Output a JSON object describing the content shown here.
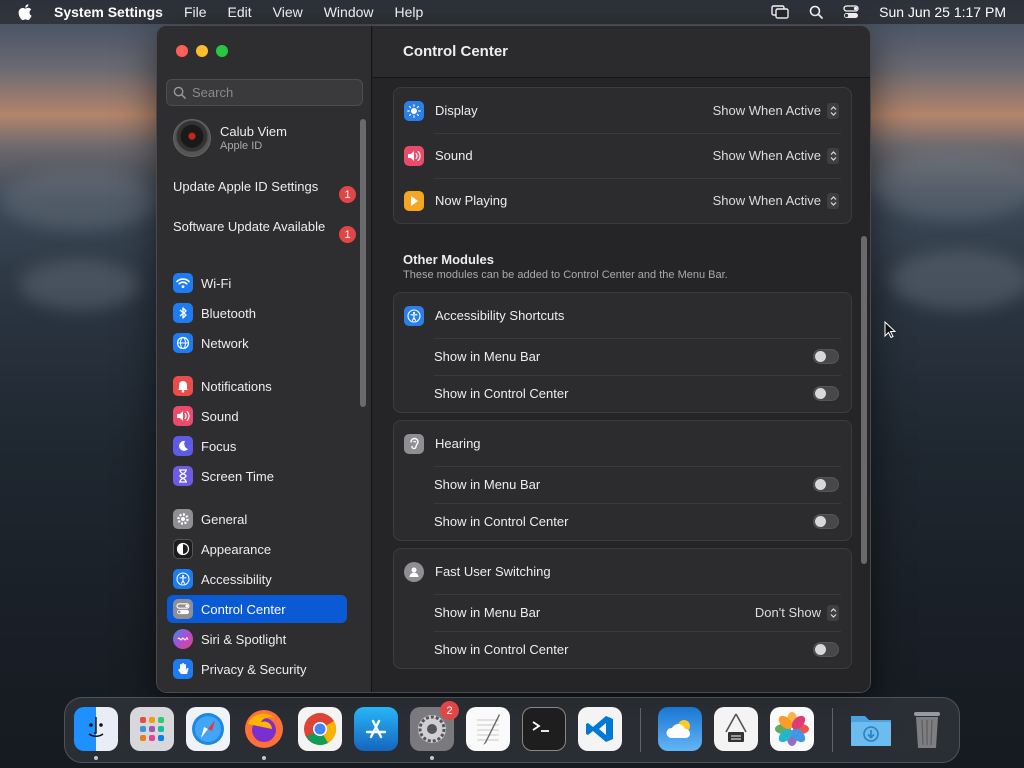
{
  "menubar": {
    "app_name": "System Settings",
    "menus": [
      "File",
      "Edit",
      "View",
      "Window",
      "Help"
    ],
    "clock": "Sun Jun 25  1:17 PM"
  },
  "window": {
    "title": "Control Center",
    "search_placeholder": "Search"
  },
  "profile": {
    "name": "Calub Viem",
    "sub": "Apple ID"
  },
  "notices": [
    {
      "label": "Update Apple ID Settings",
      "badge": "1"
    },
    {
      "label": "Software Update Available",
      "badge": "1"
    }
  ],
  "sidebar": {
    "items": [
      {
        "label": "Wi-Fi",
        "icon": "wifi-icon",
        "color": "#1e7cf2"
      },
      {
        "label": "Bluetooth",
        "icon": "bluetooth-icon",
        "color": "#1e7cf2"
      },
      {
        "label": "Network",
        "icon": "network-globe-icon",
        "color": "#1e7cf2"
      },
      {
        "label": "Notifications",
        "icon": "bell-icon",
        "color": "#ea4b4b"
      },
      {
        "label": "Sound",
        "icon": "speaker-icon",
        "color": "#ea4b6b"
      },
      {
        "label": "Focus",
        "icon": "moon-icon",
        "color": "#5e5ce6"
      },
      {
        "label": "Screen Time",
        "icon": "hourglass-icon",
        "color": "#6e5ce6"
      },
      {
        "label": "General",
        "icon": "gear-icon",
        "color": "#8e8e93"
      },
      {
        "label": "Appearance",
        "icon": "appearance-icon",
        "color": "#1c1c1e"
      },
      {
        "label": "Accessibility",
        "icon": "accessibility-icon",
        "color": "#1e7cf2"
      },
      {
        "label": "Control Center",
        "icon": "control-center-icon",
        "color": "#8e8e93"
      },
      {
        "label": "Siri & Spotlight",
        "icon": "siri-icon",
        "color": "#9a46d6"
      },
      {
        "label": "Privacy & Security",
        "icon": "hand-icon",
        "color": "#1e7cf2"
      }
    ]
  },
  "modules": [
    {
      "label": "Display",
      "value": "Show When Active",
      "icon": "display-brightness-icon",
      "color": "#2b7fe8"
    },
    {
      "label": "Sound",
      "value": "Show When Active",
      "icon": "speaker-icon",
      "color": "#ea4b6b"
    },
    {
      "label": "Now Playing",
      "value": "Show When Active",
      "icon": "play-icon",
      "color": "#f5a623"
    }
  ],
  "other_modules": {
    "title": "Other Modules",
    "subtitle": "These modules can be added to Control Center and the Menu Bar.",
    "groups": [
      {
        "label": "Accessibility Shortcuts",
        "icon": "accessibility-icon",
        "color": "#2b7fe8",
        "rows": [
          {
            "label": "Show in Menu Bar",
            "type": "toggle"
          },
          {
            "label": "Show in Control Center",
            "type": "toggle"
          }
        ]
      },
      {
        "label": "Hearing",
        "icon": "ear-icon",
        "color": "#8e8e93",
        "rows": [
          {
            "label": "Show in Menu Bar",
            "type": "toggle"
          },
          {
            "label": "Show in Control Center",
            "type": "toggle"
          }
        ]
      },
      {
        "label": "Fast User Switching",
        "icon": "user-icon",
        "color": "#8e8e93",
        "rows": [
          {
            "label": "Show in Menu Bar",
            "type": "select",
            "value": "Don't Show"
          },
          {
            "label": "Show in Control Center",
            "type": "toggle"
          }
        ]
      }
    ]
  },
  "dock": {
    "apps": [
      {
        "icon": "finder-icon",
        "running": true
      },
      {
        "icon": "launchpad-icon",
        "running": false
      },
      {
        "icon": "safari-icon",
        "running": false
      },
      {
        "icon": "firefox-icon",
        "running": true
      },
      {
        "icon": "chrome-icon",
        "running": false
      },
      {
        "icon": "app-store-icon",
        "running": false
      },
      {
        "icon": "system-settings-icon",
        "running": true,
        "badge": "2"
      },
      {
        "icon": "textedit-icon",
        "running": false
      },
      {
        "icon": "terminal-icon",
        "running": false
      },
      {
        "icon": "vscode-icon",
        "running": false
      },
      {
        "icon": "weather-icon",
        "running": false
      },
      {
        "icon": "archive-utility-icon",
        "running": false
      },
      {
        "icon": "photos-icon",
        "running": false
      },
      {
        "icon": "downloads-folder-icon",
        "running": false
      },
      {
        "icon": "trash-icon",
        "running": false
      }
    ]
  }
}
